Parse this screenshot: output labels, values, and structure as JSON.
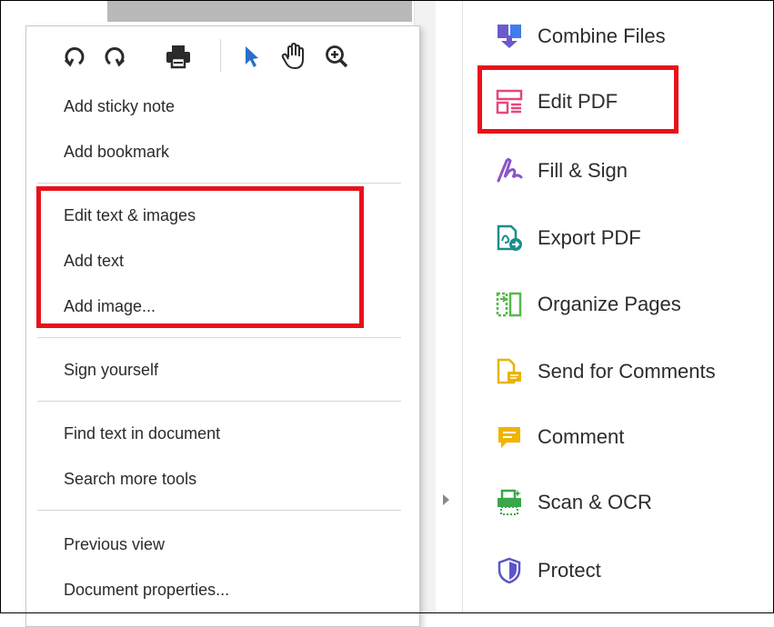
{
  "menu": {
    "toolbar": [
      {
        "icon": "rotate-left-icon"
      },
      {
        "icon": "rotate-right-icon"
      },
      {
        "icon": "printer-icon"
      },
      {
        "icon": "select-cursor-icon",
        "color": "#2670c9"
      },
      {
        "icon": "hand-pan-icon"
      },
      {
        "icon": "zoom-in-icon"
      }
    ],
    "items": [
      {
        "label": "Add sticky note"
      },
      {
        "label": "Add bookmark"
      },
      {
        "label": "Edit text & images"
      },
      {
        "label": "Add text"
      },
      {
        "label": "Add image..."
      },
      {
        "label": "Sign yourself"
      },
      {
        "label": "Find text in document"
      },
      {
        "label": "Search more tools"
      },
      {
        "label": "Previous view"
      },
      {
        "label": "Document properties..."
      }
    ]
  },
  "tools": [
    {
      "label": "Combine Files",
      "icon": "combine-files-icon",
      "color": "#6a5acd"
    },
    {
      "label": "Edit PDF",
      "icon": "edit-pdf-icon",
      "color": "#e8467c"
    },
    {
      "label": "Fill & Sign",
      "icon": "fill-sign-icon",
      "color": "#8c54c7"
    },
    {
      "label": "Export PDF",
      "icon": "export-pdf-icon",
      "color": "#1a8f8a"
    },
    {
      "label": "Organize Pages",
      "icon": "organize-pages-icon",
      "color": "#55b84a"
    },
    {
      "label": "Send for Comments",
      "icon": "send-for-comments-icon",
      "color": "#e8b400"
    },
    {
      "label": "Comment",
      "icon": "comment-icon",
      "color": "#f0b400"
    },
    {
      "label": "Scan & OCR",
      "icon": "scan-ocr-icon",
      "color": "#3aa84a"
    },
    {
      "label": "Protect",
      "icon": "protect-shield-icon",
      "color": "#5b55c7"
    }
  ],
  "highlight_color": "#e8111a"
}
